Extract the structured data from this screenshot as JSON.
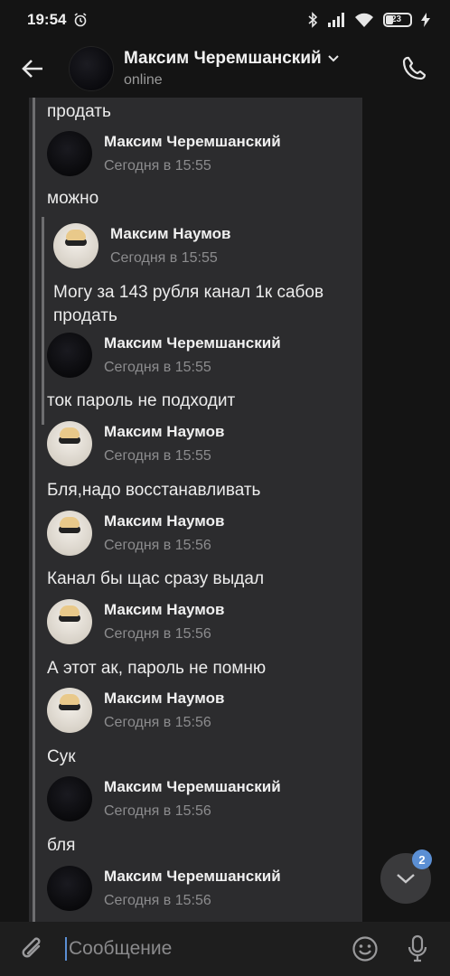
{
  "status_bar": {
    "time": "19:54",
    "battery": "23",
    "battery_level": 0.23
  },
  "header": {
    "name": "Максим Черемшанский",
    "status": "online"
  },
  "messages": [
    {
      "text": "продать"
    },
    {
      "author": "Максим Черемшанский",
      "time": "Сегодня в 15:55",
      "avatar": "dark"
    },
    {
      "text": "можно"
    },
    {
      "author": "Максим Наумов",
      "time": "Сегодня в 15:55",
      "avatar": "light",
      "nested": true
    },
    {
      "text": "Могу за 143 рубля канал 1к сабов продать",
      "nested": true
    },
    {
      "author": "Максим Черемшанский",
      "time": "Сегодня в 15:55",
      "avatar": "dark"
    },
    {
      "text": "ток пароль не подходит"
    },
    {
      "author": "Максим Наумов",
      "time": "Сегодня в 15:55",
      "avatar": "light"
    },
    {
      "text": "Бля,надо восстанавливать"
    },
    {
      "author": "Максим Наумов",
      "time": "Сегодня в 15:56",
      "avatar": "light"
    },
    {
      "text": "Канал бы щас сразу выдал"
    },
    {
      "author": "Максим Наумов",
      "time": "Сегодня в 15:56",
      "avatar": "light"
    },
    {
      "text": "А этот ак, пароль не помню"
    },
    {
      "author": "Максим Наумов",
      "time": "Сегодня в 15:56",
      "avatar": "light"
    },
    {
      "text": "Сук"
    },
    {
      "author": "Максим Черемшанский",
      "time": "Сегодня в 15:56",
      "avatar": "dark"
    },
    {
      "text": "бля"
    },
    {
      "author": "Максим Черемшанский",
      "time": "Сегодня в 15:56",
      "avatar": "dark"
    }
  ],
  "fab": {
    "badge": "2"
  },
  "composer": {
    "placeholder": "Сообщение"
  },
  "icons": {
    "back": "arrow-left-icon",
    "call": "phone-icon",
    "attach": "paperclip-icon",
    "emoji": "smile-icon",
    "mic": "microphone-icon",
    "scroll": "chevron-down-icon"
  },
  "colors": {
    "accent": "#5b8fd4",
    "bubble": "#2c2c2e",
    "background": "#141414"
  }
}
